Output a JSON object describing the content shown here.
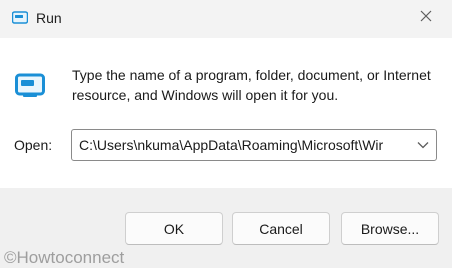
{
  "window": {
    "title": "Run",
    "title_icon": "run-app-icon",
    "close_icon": "close-icon"
  },
  "content": {
    "icon": "run-program-icon",
    "description": "Type the name of a program, folder, document, or Internet resource, and Windows will open it for you.",
    "open_label": "Open:",
    "open_value": "C:\\Users\\nkuma\\AppData\\Roaming\\Microsoft\\Wir"
  },
  "buttons": {
    "ok": "OK",
    "cancel": "Cancel",
    "browse": "Browse..."
  },
  "watermark": "©Howtoconnect",
  "colors": {
    "accent": "#1a8fd6",
    "content_bg": "#ffffff",
    "footer_bg": "#f0f0f0"
  }
}
